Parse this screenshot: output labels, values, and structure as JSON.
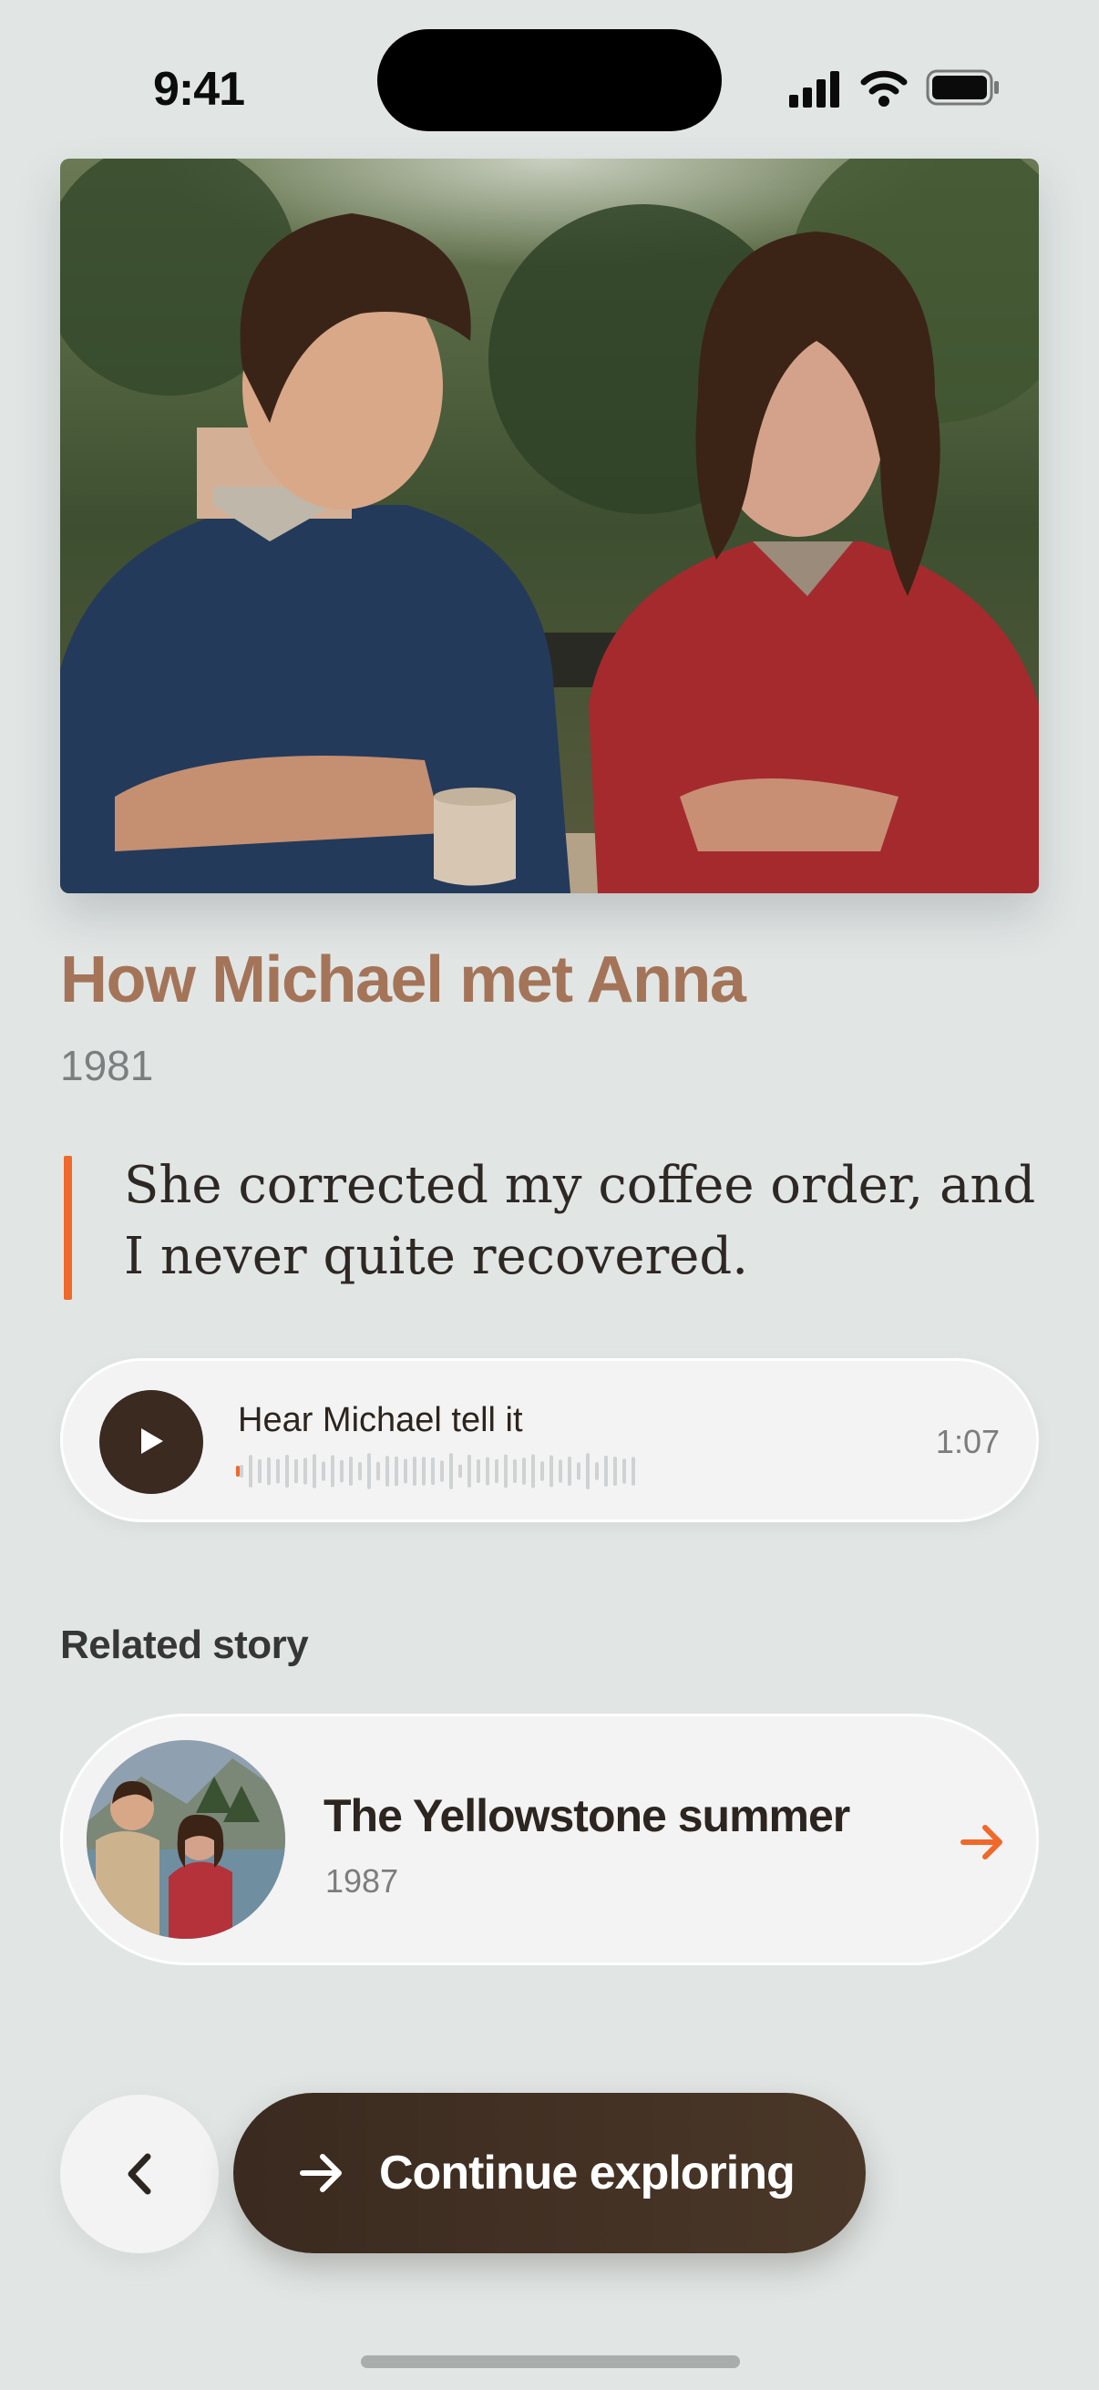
{
  "status_bar": {
    "time": "9:41"
  },
  "story": {
    "title": "How Michael met Anna",
    "year": "1981",
    "quote": "She corrected my coffee order, and I never quite recovered."
  },
  "audio": {
    "label": "Hear Michael tell it",
    "duration": "1:07",
    "progress": 0.0
  },
  "related": {
    "heading": "Related story",
    "title": "The Yellowstone summer",
    "year": "1987"
  },
  "actions": {
    "continue_label": "Continue exploring"
  },
  "colors": {
    "accent": "#f0682a",
    "title": "#a47459",
    "dark_button": "#3a2a20",
    "background": "#e1e6e5"
  },
  "icons": {
    "play": "play-icon",
    "back": "chevron-left-icon",
    "continue": "arrow-right-icon",
    "related": "arrow-right-icon"
  }
}
